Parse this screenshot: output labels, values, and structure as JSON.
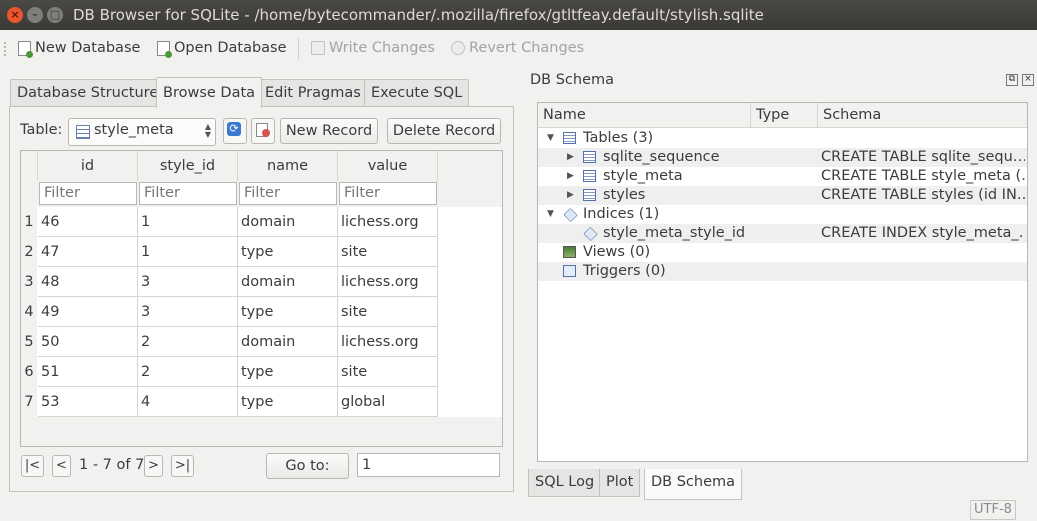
{
  "window": {
    "title": "DB Browser for SQLite - /home/bytecommander/.mozilla/firefox/gtltfeay.default/stylish.sqlite",
    "close_glyph": "×",
    "min_glyph": "–",
    "max_glyph": "□"
  },
  "toolbar": {
    "new_database": "New Database",
    "open_database": "Open Database",
    "write_changes": "Write Changes",
    "revert_changes": "Revert Changes"
  },
  "tabs": [
    {
      "label": "Database Structure"
    },
    {
      "label": "Browse Data",
      "active": true
    },
    {
      "label": "Edit Pragmas"
    },
    {
      "label": "Execute SQL"
    }
  ],
  "browse": {
    "table_label": "Table:",
    "table_value": "style_meta",
    "new_record": "New Record",
    "delete_record": "Delete Record",
    "filter_placeholder": "Filter",
    "columns": [
      "id",
      "style_id",
      "name",
      "value"
    ],
    "rows": [
      {
        "num": "1",
        "cells": [
          "46",
          "1",
          "domain",
          "lichess.org"
        ]
      },
      {
        "num": "2",
        "cells": [
          "47",
          "1",
          "type",
          "site"
        ]
      },
      {
        "num": "3",
        "cells": [
          "48",
          "3",
          "domain",
          "lichess.org"
        ]
      },
      {
        "num": "4",
        "cells": [
          "49",
          "3",
          "type",
          "site"
        ]
      },
      {
        "num": "5",
        "cells": [
          "50",
          "2",
          "domain",
          "lichess.org"
        ]
      },
      {
        "num": "6",
        "cells": [
          "51",
          "2",
          "type",
          "site"
        ]
      },
      {
        "num": "7",
        "cells": [
          "53",
          "4",
          "type",
          "global"
        ]
      }
    ],
    "nav": {
      "first": "|<",
      "prev": "<",
      "label": "1 - 7 of 7",
      "next": ">",
      "last": ">|",
      "goto_label": "Go to:",
      "goto_value": "1"
    }
  },
  "schema": {
    "title": "DB Schema",
    "columns": [
      "Name",
      "Type",
      "Schema"
    ],
    "items": [
      {
        "name": "Tables (3)",
        "type": "",
        "schema": "",
        "icon": "table-icon",
        "level": 0,
        "expanded": true
      },
      {
        "name": "sqlite_sequence",
        "type": "",
        "schema": "CREATE TABLE sqlite_sequ…",
        "icon": "table-icon",
        "level": 1,
        "expandable": true
      },
      {
        "name": "style_meta",
        "type": "",
        "schema": "CREATE TABLE style_meta (…",
        "icon": "table-icon",
        "level": 1,
        "expandable": true
      },
      {
        "name": "styles",
        "type": "",
        "schema": "CREATE TABLE styles (id IN…",
        "icon": "table-icon",
        "level": 1,
        "expandable": true
      },
      {
        "name": "Indices (1)",
        "type": "",
        "schema": "",
        "icon": "tag-icon",
        "level": 0,
        "expanded": true
      },
      {
        "name": "style_meta_style_id",
        "type": "",
        "schema": "CREATE INDEX style_meta_…",
        "icon": "tag-icon",
        "level": 1
      },
      {
        "name": "Views (0)",
        "type": "",
        "schema": "",
        "icon": "view-icon",
        "level": 0
      },
      {
        "name": "Triggers (0)",
        "type": "",
        "schema": "",
        "icon": "trigger-icon",
        "level": 0
      }
    ],
    "bottom_tabs": [
      {
        "label": "SQL Log"
      },
      {
        "label": "Plot"
      },
      {
        "label": "DB Schema",
        "active": true
      }
    ]
  },
  "status": {
    "encoding": "UTF-8"
  }
}
